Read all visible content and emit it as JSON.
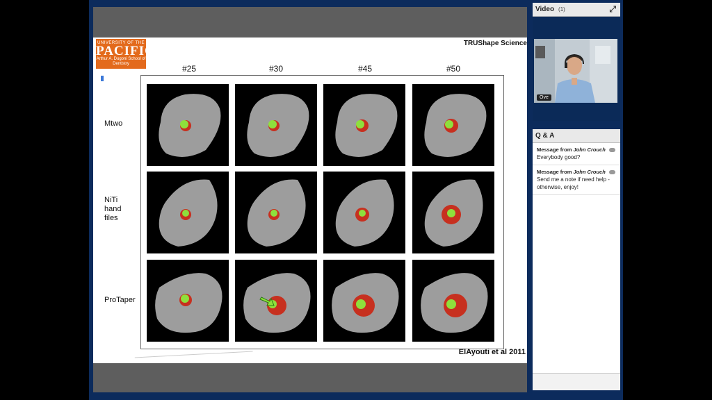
{
  "video": {
    "title": "Video",
    "count": "(1)",
    "presenter_name": "Ove"
  },
  "qa": {
    "title": "Q & A",
    "messages": [
      {
        "prefix": "Message from",
        "author": "John Crouch",
        "text": "Everybody good?"
      },
      {
        "prefix": "Message from",
        "author": "John Crouch",
        "text": "Send me a note if need help - otherwise, enjoy!"
      }
    ]
  },
  "slide": {
    "logo": {
      "line1": "UNIVERSITY OF THE",
      "line2": "PACIFIC",
      "line3": "Arthur A. Dugoni School of Dentistry"
    },
    "title": "TRUShape Science",
    "columns": [
      "#25",
      "#30",
      "#45",
      "#50"
    ],
    "rows": [
      "Mtwo",
      "NiTi hand files",
      "ProTaper"
    ],
    "citation": "ElAyouti et al 2011"
  },
  "colors": {
    "frame": "#0c2b5c",
    "logo_bg": "#e36a1c",
    "canal_green": "#8ee03c",
    "canal_red": "#c7301f"
  }
}
